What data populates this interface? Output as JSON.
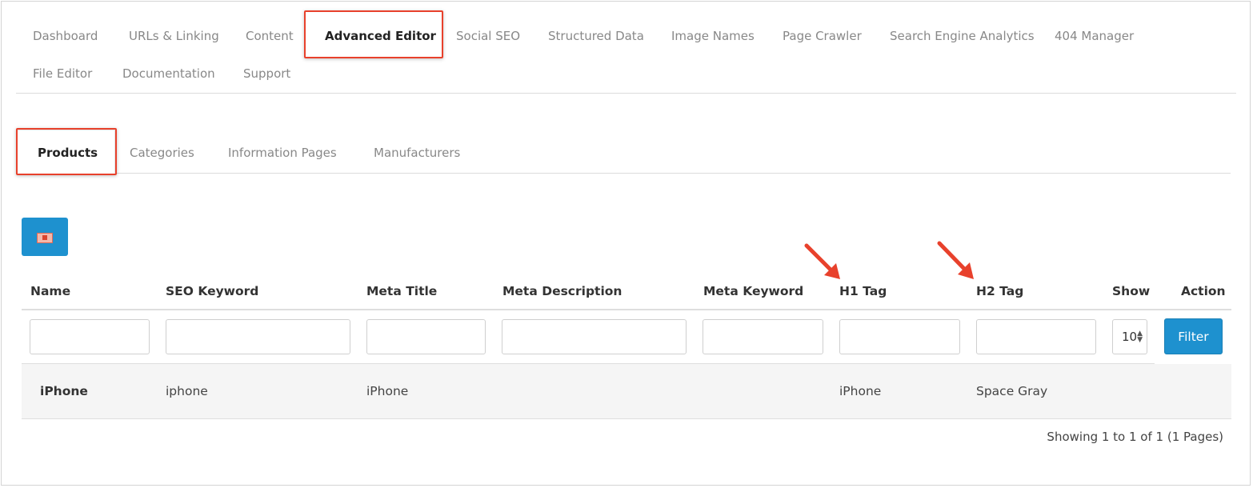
{
  "main_tabs": [
    {
      "label": "Dashboard"
    },
    {
      "label": "URLs & Linking"
    },
    {
      "label": "Content"
    },
    {
      "label": "Advanced Editor"
    },
    {
      "label": "Social SEO"
    },
    {
      "label": "Structured Data"
    },
    {
      "label": "Image Names"
    },
    {
      "label": "Page Crawler"
    },
    {
      "label": "Search Engine Analytics"
    },
    {
      "label": "404 Manager"
    },
    {
      "label": "File Editor"
    },
    {
      "label": "Documentation"
    },
    {
      "label": "Support"
    }
  ],
  "main_tabs_active": "Advanced Editor",
  "sub_tabs": [
    {
      "label": "Products"
    },
    {
      "label": "Categories"
    },
    {
      "label": "Information Pages"
    },
    {
      "label": "Manufacturers"
    }
  ],
  "sub_tabs_active": "Products",
  "export_button": {
    "icon": "spreadsheet-export-icon"
  },
  "table": {
    "columns": [
      "Name",
      "SEO Keyword",
      "Meta Title",
      "Meta Description",
      "Meta Keyword",
      "H1 Tag",
      "H2 Tag",
      "Show",
      "Action"
    ],
    "filters": {
      "name": "",
      "seo_keyword": "",
      "meta_title": "",
      "meta_description": "",
      "meta_keyword": "",
      "h1_tag": "",
      "h2_tag": "",
      "show": "10"
    },
    "filter_button": "Filter",
    "rows": [
      {
        "name": "iPhone",
        "seo_keyword": "iphone",
        "meta_title": "iPhone",
        "meta_description": "",
        "meta_keyword": "",
        "h1_tag": "iPhone",
        "h2_tag": "Space Gray"
      }
    ],
    "pagination_text": "Showing 1 to 1 of 1 (1 Pages)"
  },
  "colors": {
    "accent": "#1e91cf",
    "highlight": "#e8412c",
    "annotation_arrow": "#e8412c"
  }
}
